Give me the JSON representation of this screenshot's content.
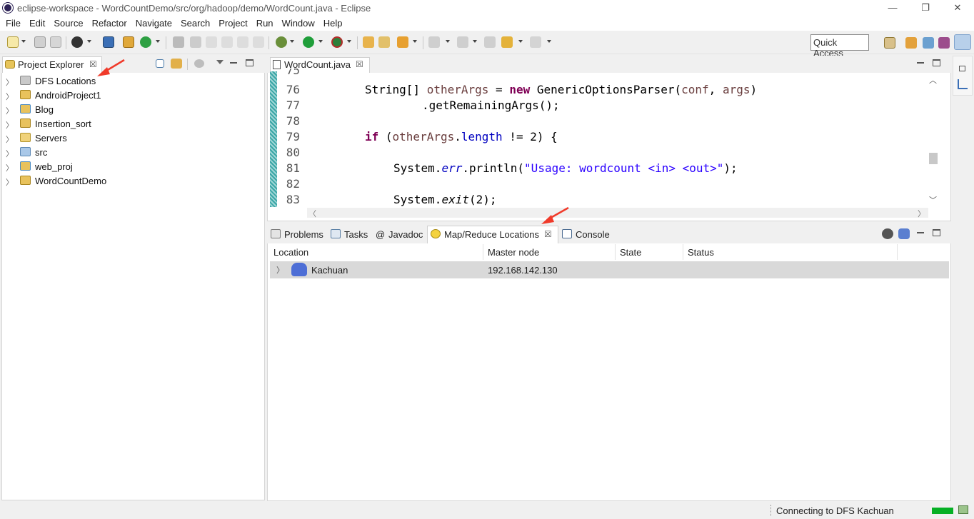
{
  "window": {
    "title": "eclipse-workspace - WordCountDemo/src/org/hadoop/demo/WordCount.java - Eclipse",
    "minimize": "—",
    "restore": "❐",
    "close": "✕"
  },
  "menu": [
    "File",
    "Edit",
    "Source",
    "Refactor",
    "Navigate",
    "Search",
    "Project",
    "Run",
    "Window",
    "Help"
  ],
  "toolbar": {
    "quick_access": "Quick Access"
  },
  "project_explorer": {
    "tab_label": "Project Explorer",
    "close": "☒",
    "items": [
      {
        "label": "DFS Locations",
        "icon": "dfs-icon"
      },
      {
        "label": "AndroidProject1",
        "icon": "android-project-icon"
      },
      {
        "label": "Blog",
        "icon": "web-project-icon"
      },
      {
        "label": "Insertion_sort",
        "icon": "project-icon"
      },
      {
        "label": "Servers",
        "icon": "folder-icon"
      },
      {
        "label": "src",
        "icon": "folder-icon"
      },
      {
        "label": "web_proj",
        "icon": "web-project-icon"
      },
      {
        "label": "WordCountDemo",
        "icon": "project-icon"
      }
    ]
  },
  "editor": {
    "tab_label": "WordCount.java",
    "close": "☒",
    "line_numbers": [
      "75",
      "76",
      "77",
      "78",
      "79",
      "80",
      "81",
      "82",
      "83"
    ],
    "code": {
      "l76_a": "String[] ",
      "l76_b": "otherArgs",
      "l76_c": " = ",
      "l76_d": "new",
      "l76_e": " GenericOptionsParser(",
      "l76_f": "conf",
      "l76_g": ", ",
      "l76_h": "args",
      "l76_i": ")",
      "l77": ".getRemainingArgs();",
      "l79_a": "if",
      "l79_b": " (",
      "l79_c": "otherArgs",
      "l79_d": ".",
      "l79_e": "length",
      "l79_f": " != 2) {",
      "l81_a": "System.",
      "l81_b": "err",
      "l81_c": ".println(",
      "l81_d": "\"Usage: wordcount <in> <out>\"",
      "l81_e": ");",
      "l83_a": "System.",
      "l83_b": "exit",
      "l83_c": "(2);"
    }
  },
  "bottom_panel": {
    "tabs": [
      {
        "label": "Problems",
        "icon": "problems-icon"
      },
      {
        "label": "Tasks",
        "icon": "tasks-icon"
      },
      {
        "label": "Javadoc",
        "icon": "javadoc-icon"
      },
      {
        "label": "Map/Reduce Locations",
        "icon": "mapreduce-icon",
        "active": true
      },
      {
        "label": "Console",
        "icon": "console-icon"
      }
    ],
    "javadoc_prefix": "@",
    "close": "☒",
    "columns": [
      "Location",
      "Master node",
      "State",
      "Status"
    ],
    "rows": [
      {
        "location": "Kachuan",
        "master_node": "192.168.142.130",
        "state": "",
        "status": ""
      }
    ]
  },
  "status_bar": {
    "message": "Connecting to DFS Kachuan"
  },
  "colors": {
    "accent_arrow": "#f03a2a",
    "keyword": "#7f0055",
    "string": "#2a00ff",
    "field": "#0000c0"
  }
}
